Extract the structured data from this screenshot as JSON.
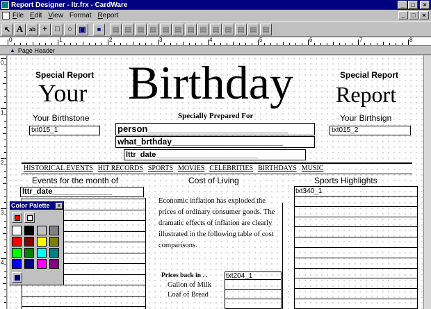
{
  "window": {
    "title": "Report Designer - ltr.frx - CardWare"
  },
  "window_buttons": {
    "minimize": "_",
    "maximize": "□",
    "close": "×"
  },
  "menu": {
    "items": [
      {
        "label": "File",
        "accel": "F",
        "rest": "ile"
      },
      {
        "label": "Edit",
        "accel": "E",
        "rest": "dit"
      },
      {
        "label": "View",
        "accel": "V",
        "rest": "iew"
      },
      {
        "label": "Format",
        "accel": "",
        "rest": "Format"
      },
      {
        "label": "Report",
        "accel": "R",
        "rest": "eport"
      }
    ]
  },
  "toolbar": {
    "tools": [
      {
        "name": "pointer-tool",
        "glyph": "↖"
      },
      {
        "name": "label-tool",
        "glyph": "A"
      },
      {
        "name": "field-tool",
        "glyph": "ab"
      },
      {
        "name": "line-tool",
        "glyph": "+"
      },
      {
        "name": "rectangle-tool",
        "glyph": "□"
      },
      {
        "name": "ellipse-tool",
        "glyph": "○"
      },
      {
        "name": "picture-tool",
        "glyph": "▣"
      }
    ],
    "lock": {
      "glyph": "🔒"
    },
    "align_glyph": "▤",
    "align_count": 13
  },
  "ruler": {
    "marks": [
      "0",
      "1",
      "2",
      "3",
      "4",
      "5",
      "6",
      "7",
      "8"
    ],
    "vmarks": [
      "0",
      "1",
      "2",
      "3",
      "4"
    ]
  },
  "band": {
    "arrow": "▲",
    "label": "Page Header"
  },
  "report": {
    "left_special": "Special Report",
    "left_big": "Your",
    "title_big": "Birthday",
    "right_special": "Special Report",
    "right_big": "Report",
    "prepared_for": "Specially Prepared For",
    "birthstone_label": "Your Birthstone",
    "birthsign_label": "Your Birthsign",
    "txt015_1": "txt015_1",
    "txt015_2": "txt015_2",
    "person": "person",
    "what_brthday": "what_brthday",
    "lttr_date": "lttr_date",
    "nav": [
      "HISTORICAL EVENTS",
      "HIT RECORDS",
      "SPORTS",
      "MOVIES",
      "CELEBRITIES",
      "BIRTHDAYS",
      "MUSIC"
    ],
    "events_heading": "Events for the month of",
    "events_field": "lttr_date",
    "cost_heading": "Cost of Living",
    "cost_text": "Economic inflation has exploded the prices of ordinary consumer goods. The dramatic effects of inflation are clearly illustrated in the following table of cost comparisons.",
    "prices_back": "Prices back in . .",
    "price_items": [
      "Gallon of Milk",
      "Loaf of Bread"
    ],
    "txt204_1": "txt204_1",
    "sports_heading": "Sports Highlights",
    "txt340_1": "txt340_1"
  },
  "palette": {
    "title": "Color Palette",
    "close": "x",
    "colors": [
      "#ffffff",
      "#000000",
      "#c0c0c0",
      "#808080",
      "#ff0000",
      "#800000",
      "#ffff00",
      "#808000",
      "#00ff00",
      "#008000",
      "#00ffff",
      "#008080",
      "#0000ff",
      "#000080",
      "#ff00ff",
      "#800080"
    ]
  }
}
